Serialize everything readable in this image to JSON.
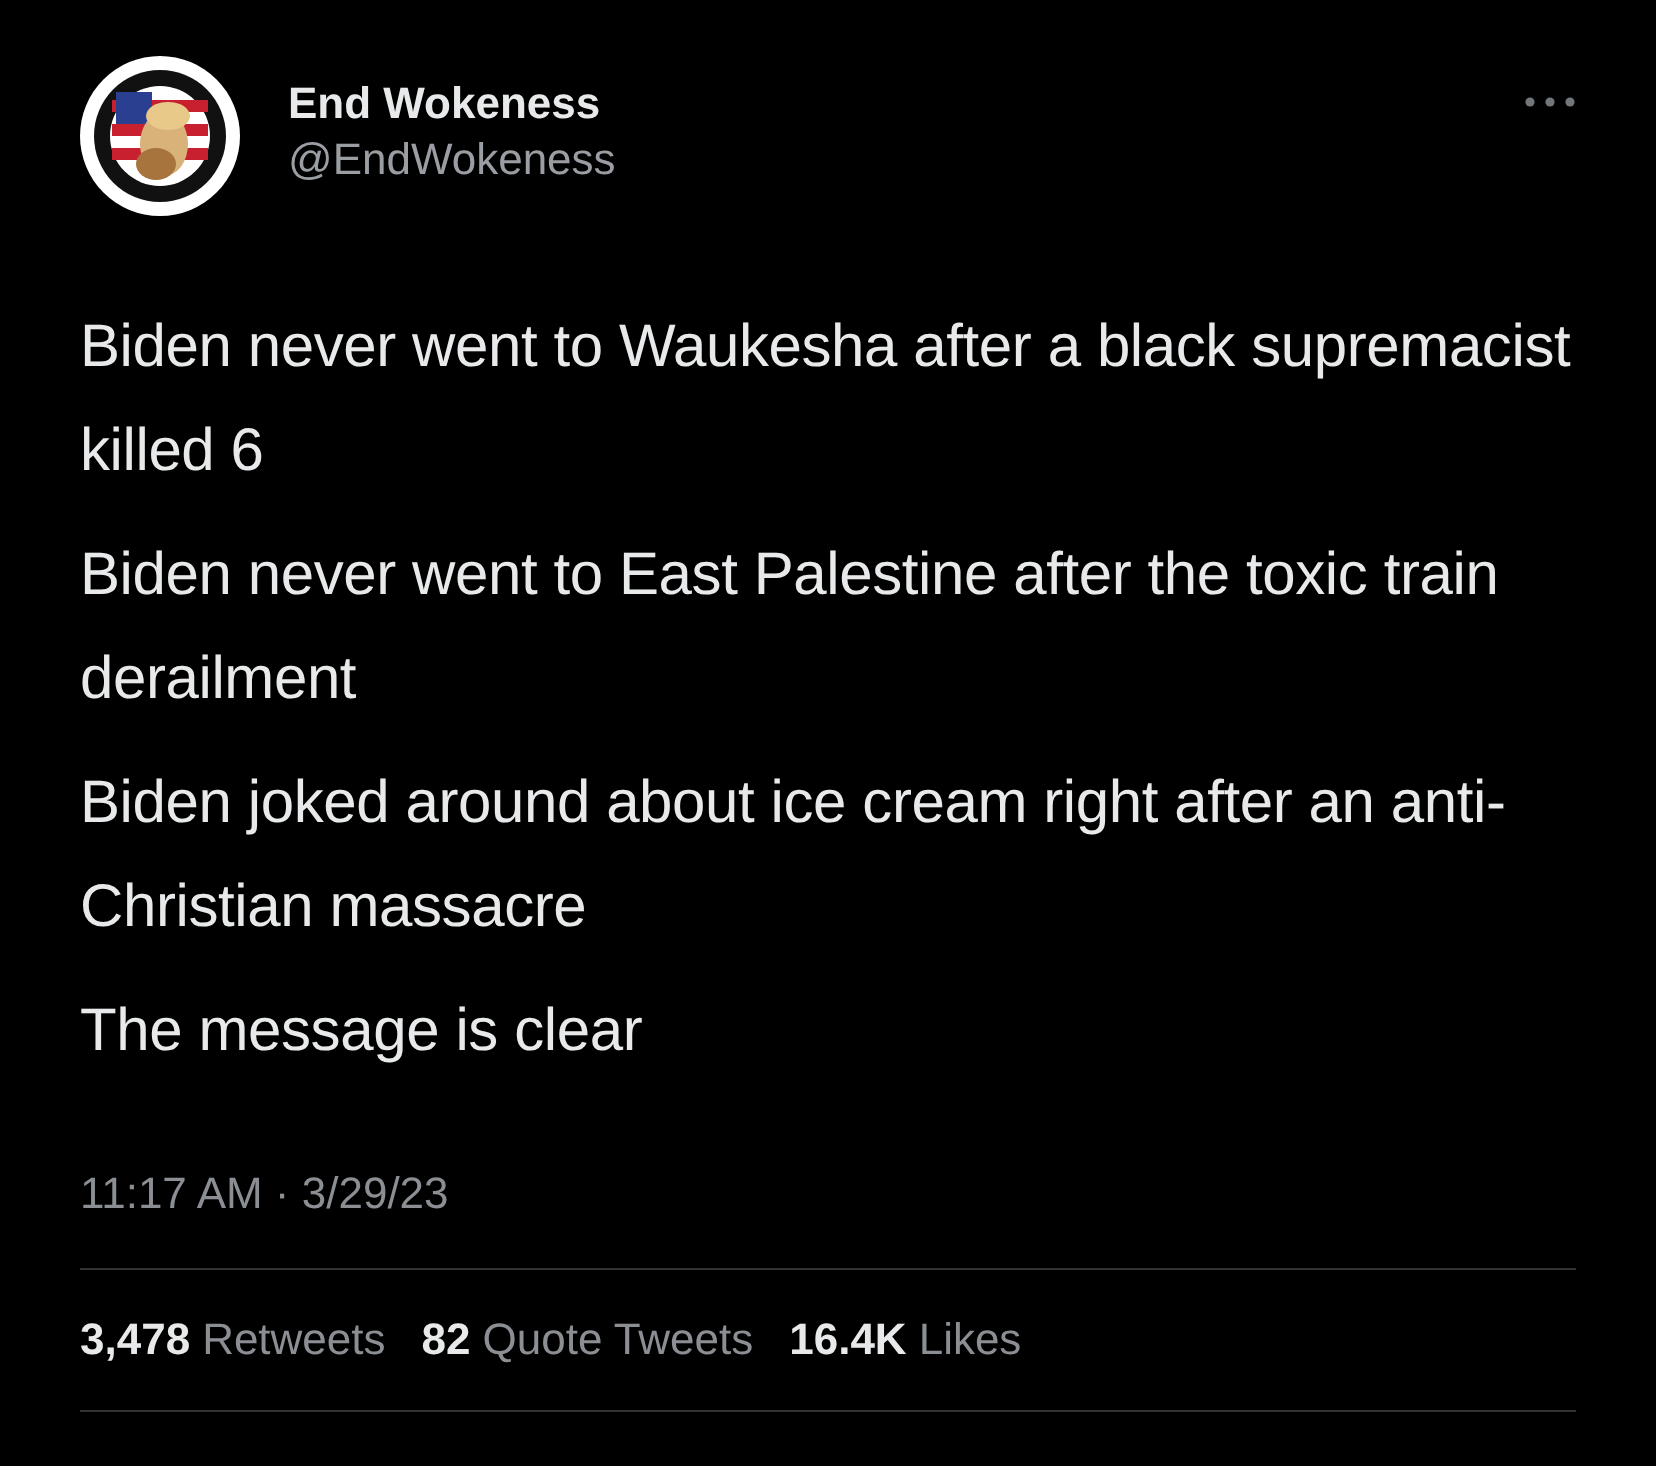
{
  "author": {
    "name": "End Wokeness",
    "handle": "@EndWokeness"
  },
  "paragraphs": [
    "Biden never went to Waukesha after a black supremacist killed 6",
    "Biden never went to East Palestine after the toxic train derailment",
    "Biden joked around about ice cream right after an anti-Christian massacre",
    "The message is clear"
  ],
  "timestamp": "11:17 AM · 3/29/23",
  "stats": [
    {
      "count": "3,478",
      "label": "Retweets"
    },
    {
      "count": "82",
      "label": "Quote Tweets"
    },
    {
      "count": "16.4K",
      "label": "Likes"
    }
  ]
}
